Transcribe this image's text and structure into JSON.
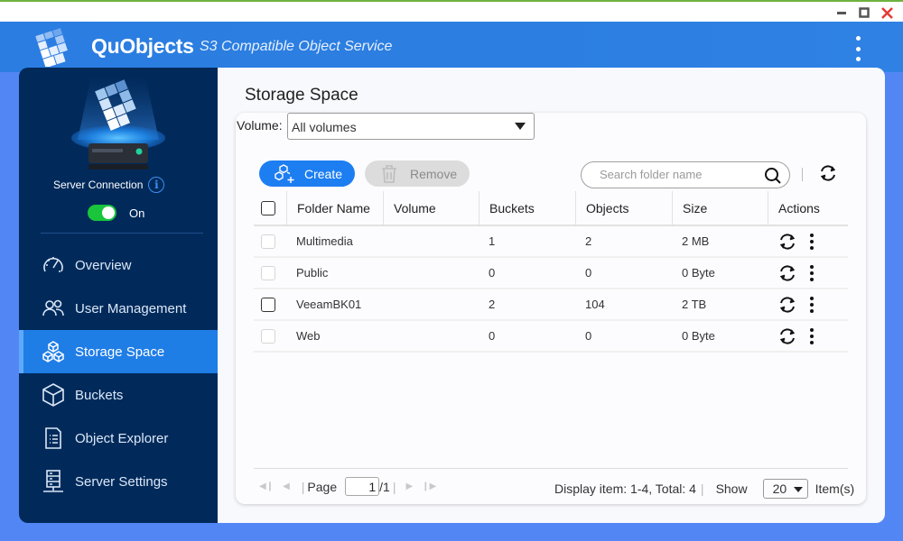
{
  "window": {
    "controls": [
      "minimize",
      "maximize",
      "close"
    ]
  },
  "header": {
    "app_name": "QuObjects",
    "subtitle": "S3 Compatible Object Service"
  },
  "sidebar": {
    "server_connection_label": "Server Connection",
    "toggle_label": "On",
    "toggle_state": true,
    "items": [
      {
        "label": "Overview",
        "icon": "gauge-icon"
      },
      {
        "label": "User Management",
        "icon": "users-icon"
      },
      {
        "label": "Storage Space",
        "icon": "cubes-icon",
        "active": true
      },
      {
        "label": "Buckets",
        "icon": "cube-icon"
      },
      {
        "label": "Object Explorer",
        "icon": "document-list-icon"
      },
      {
        "label": "Server Settings",
        "icon": "server-icon"
      }
    ]
  },
  "main": {
    "title": "Storage Space",
    "volume_label": "Volume:",
    "volume_value": "All volumes",
    "create_label": "Create",
    "remove_label": "Remove",
    "search_placeholder": "Search folder name",
    "table": {
      "columns": [
        "Folder Name",
        "Volume",
        "Buckets",
        "Objects",
        "Size",
        "Actions"
      ],
      "rows": [
        {
          "folder": "Multimedia",
          "volume": "",
          "buckets": "1",
          "objects": "2",
          "size": "2 MB"
        },
        {
          "folder": "Public",
          "volume": "",
          "buckets": "0",
          "objects": "0",
          "size": "0 Byte"
        },
        {
          "folder": "VeeamBK01",
          "volume": "",
          "buckets": "2",
          "objects": "104",
          "size": "2 TB"
        },
        {
          "folder": "Web",
          "volume": "",
          "buckets": "0",
          "objects": "0",
          "size": "0 Byte"
        }
      ]
    },
    "pagination": {
      "page_label": "Page",
      "current_page": "1",
      "total_pages": "/1",
      "display_text": "Display item: 1-4, Total: 4",
      "show_label": "Show",
      "page_size": "20",
      "items_label": "Item(s)"
    }
  },
  "colors": {
    "accent": "#1d7ef2",
    "sidebar_bg": "#012a5b",
    "header_bg": "#2b7de1",
    "toggle_on": "#19c53a"
  }
}
